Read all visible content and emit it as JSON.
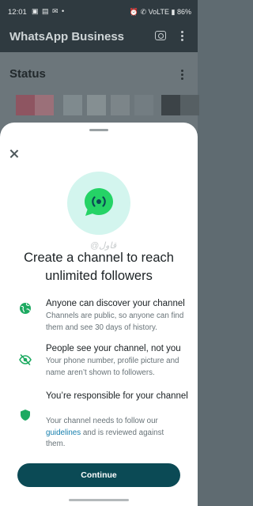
{
  "status_bar": {
    "time": "12:01",
    "icons": "▣ ▤ ✉ •",
    "right": "⏰ ✆ VoLTE ▮ 86%"
  },
  "app_bar": {
    "title": "WhatsApp Business"
  },
  "status_section": {
    "label": "Status"
  },
  "sheet": {
    "watermark": "@قاول",
    "headline_line1": "Create a channel to reach",
    "headline_line2": "unlimited followers",
    "features": [
      {
        "icon": "globe-icon",
        "title": "Anyone can discover your channel",
        "description": "Channels are public, so anyone can find them and see 30 days of history."
      },
      {
        "icon": "eye-off-icon",
        "title": "People see your channel, not you",
        "description": "Your phone number, profile picture and name aren’t shown to followers."
      },
      {
        "icon": "shield-icon",
        "title": "You’re responsible for your channel",
        "description_before": "Your channel needs to follow our ",
        "link": "guidelines",
        "description_after": " and is reviewed against them."
      }
    ],
    "continue_label": "Continue"
  },
  "colors": {
    "accent": "#0b4a55",
    "icon_green": "#1daa61",
    "hero_bg": "#d3f5ee",
    "link": "#167fad"
  }
}
